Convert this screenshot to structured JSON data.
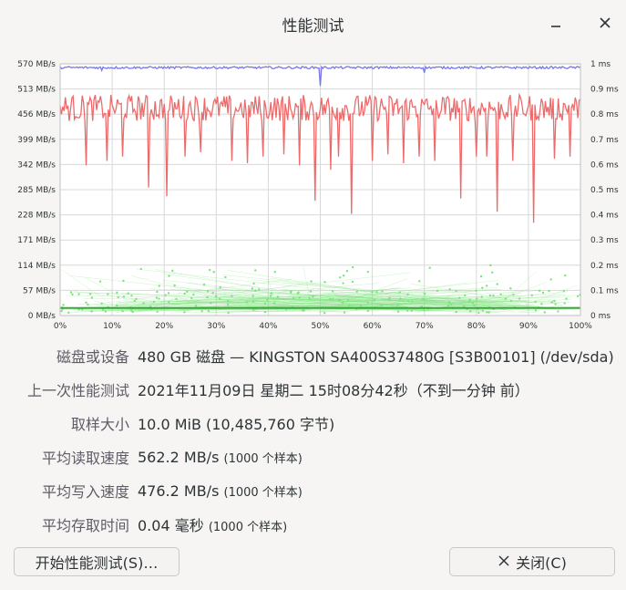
{
  "window": {
    "title": "性能测试",
    "minimize_icon": "minimize-icon",
    "close_icon": "close-icon"
  },
  "info": {
    "device": {
      "label": "磁盘或设备",
      "value": "480 GB 磁盘 — KINGSTON SA400S37480G [S3B00101] (/dev/sda)"
    },
    "last_test": {
      "label": "上一次性能测试",
      "value": "2021年11月09日 星期二 15时08分42秒（不到一分钟 前）"
    },
    "sample_size": {
      "label": "取样大小",
      "value": "10.0 MiB (10,485,760 字节)"
    },
    "avg_read": {
      "label": "平均读取速度",
      "value": "562.2 MB/s",
      "note": "(1000 个样本)"
    },
    "avg_write": {
      "label": "平均写入速度",
      "value": "476.2 MB/s",
      "note": "(1000 个样本)"
    },
    "avg_access": {
      "label": "平均存取时间",
      "value": "0.04 毫秒",
      "note": "(1000 个样本)"
    }
  },
  "buttons": {
    "start": "开始性能测试(S)…",
    "close": "关闭(C)"
  },
  "chart_data": {
    "type": "line",
    "x_ticks": [
      "0%",
      "10%",
      "20%",
      "30%",
      "40%",
      "50%",
      "60%",
      "70%",
      "80%",
      "90%",
      "100%"
    ],
    "y_left_ticks": [
      "0 MB/s",
      "57 MB/s",
      "114 MB/s",
      "171 MB/s",
      "228 MB/s",
      "285 MB/s",
      "342 MB/s",
      "399 MB/s",
      "456 MB/s",
      "513 MB/s",
      "570 MB/s"
    ],
    "y_right_ticks": [
      "0 ms",
      "0.1 ms",
      "0.2 ms",
      "0.3 ms",
      "0.4 ms",
      "0.5 ms",
      "0.6 ms",
      "0.7 ms",
      "0.8 ms",
      "0.9 ms",
      "1 ms"
    ],
    "y_left_range": [
      0,
      570
    ],
    "y_right_range": [
      0,
      1
    ],
    "grid": true,
    "colors": {
      "read": "#7777e8",
      "write": "#ee6a6a",
      "access": "#7ee27e"
    },
    "series": [
      {
        "id": "read",
        "approx_value": 562,
        "dips": [
          [
            0.08,
            555
          ],
          [
            0.5,
            520
          ],
          [
            0.7,
            550
          ]
        ]
      },
      {
        "id": "write",
        "approx_value": 476,
        "range": [
          440,
          500
        ],
        "spikes": [
          [
            0.05,
            340
          ],
          [
            0.09,
            350
          ],
          [
            0.12,
            360
          ],
          [
            0.17,
            290
          ],
          [
            0.205,
            270
          ],
          [
            0.24,
            360
          ],
          [
            0.27,
            370
          ],
          [
            0.33,
            350
          ],
          [
            0.36,
            345
          ],
          [
            0.39,
            360
          ],
          [
            0.43,
            365
          ],
          [
            0.46,
            340
          ],
          [
            0.49,
            260
          ],
          [
            0.52,
            330
          ],
          [
            0.535,
            360
          ],
          [
            0.56,
            230
          ],
          [
            0.6,
            350
          ],
          [
            0.63,
            365
          ],
          [
            0.66,
            345
          ],
          [
            0.69,
            360
          ],
          [
            0.72,
            350
          ],
          [
            0.77,
            265
          ],
          [
            0.8,
            360
          ],
          [
            0.82,
            360
          ],
          [
            0.84,
            235
          ],
          [
            0.87,
            350
          ],
          [
            0.91,
            210
          ],
          [
            0.95,
            355
          ],
          [
            0.98,
            360
          ]
        ]
      },
      {
        "id": "access",
        "approx_value": 0.03,
        "range": [
          0.0,
          0.2
        ]
      }
    ]
  }
}
